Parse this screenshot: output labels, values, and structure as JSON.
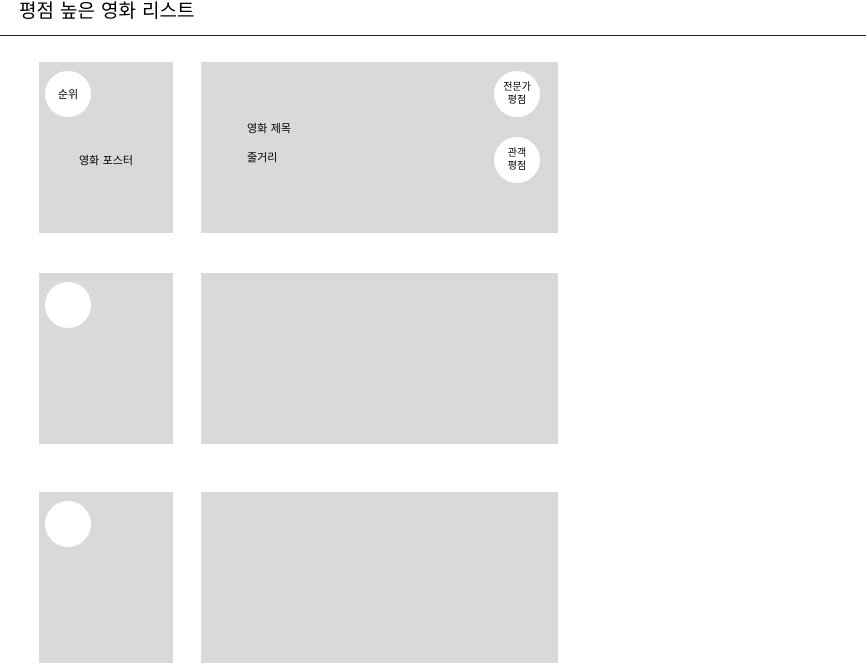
{
  "page": {
    "title": "평점 높은 영화 리스트"
  },
  "movies": [
    {
      "rank_label": "순위",
      "poster_label": "영화 포스터",
      "title_label": "영화 제목",
      "plot_label": "줄거리",
      "critic_score_label": "전문가\n평점",
      "audience_score_label": "관객\n평점"
    },
    {
      "rank_label": "",
      "poster_label": "",
      "title_label": "",
      "plot_label": "",
      "critic_score_label": "",
      "audience_score_label": ""
    },
    {
      "rank_label": "",
      "poster_label": "",
      "title_label": "",
      "plot_label": "",
      "critic_score_label": "",
      "audience_score_label": ""
    }
  ]
}
